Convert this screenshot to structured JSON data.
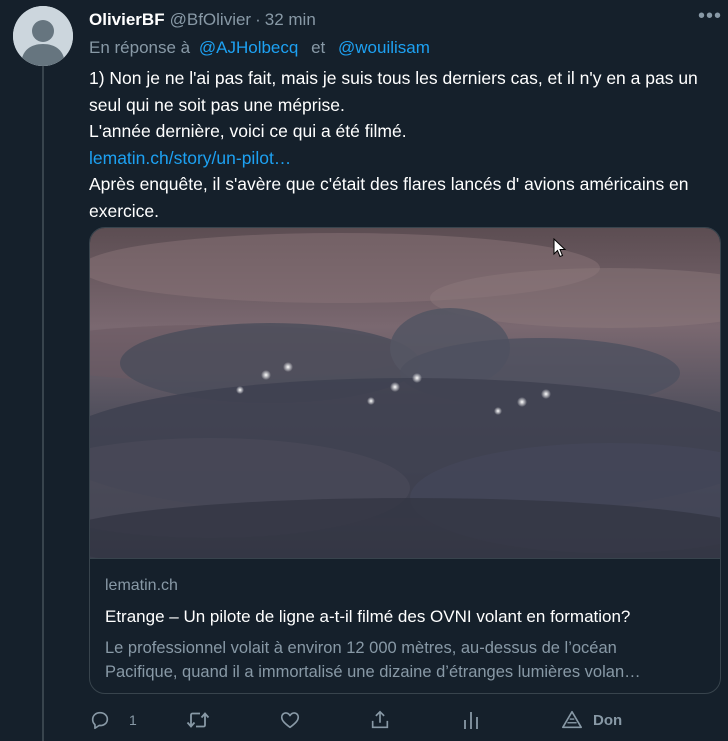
{
  "tweet": {
    "display_name": "OlivierBF",
    "handle": "@BfOlivier",
    "separator": "·",
    "time": "32 min",
    "more_icon": "more-horizontal-icon",
    "reply_prefix": "En réponse à",
    "mentions": [
      "@AJHolbecq",
      "@wouilisam"
    ],
    "mention_joiner": "et",
    "text_lines": [
      "1) Non je ne l'ai pas fait, mais je suis tous les derniers cas, et il n'y en a pas un seul qui ne soit pas une méprise.",
      "L'année dernière, voici ce qui a été filmé."
    ],
    "link": "lematin.ch/story/un-pilot…",
    "text_after_link": "Après enquête, il s'avère que c'était des flares lancés d' avions américains en exercice."
  },
  "card": {
    "domain": "lematin.ch",
    "title": "Etrange – Un pilote de ligne a-t-il filmé des OVNI volant en formation?",
    "description_lines": [
      "Le  professionnel volait à environ 12 000 mètres, au-dessus de l’océan",
      "Pacifique, quand il a immortalisé une dizaine d’étranges lumières volan…"
    ]
  },
  "actions": {
    "reply_count": "1",
    "share_label": "Don",
    "icons": [
      "reply-icon",
      "retweet-icon",
      "like-icon",
      "share-icon",
      "analytics-icon",
      "donate-icon"
    ]
  },
  "colors": {
    "background": "#15202b",
    "border": "#38444d",
    "muted": "#8899a6",
    "link": "#1da1f2",
    "text": "#ffffff"
  }
}
